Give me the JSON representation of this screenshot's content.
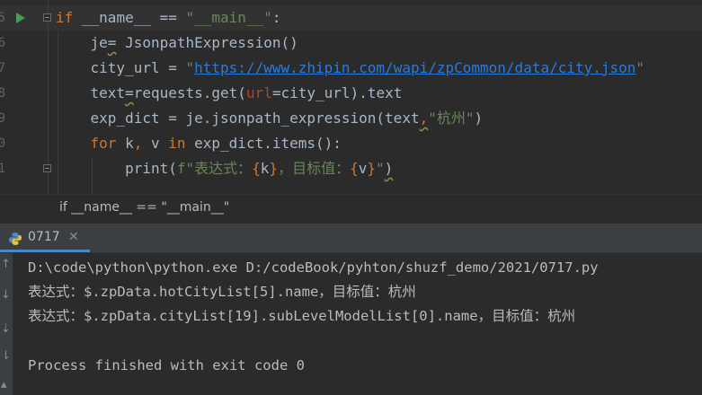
{
  "editor": {
    "lines": [
      {
        "num": "5",
        "parts": [
          {
            "t": "if ",
            "c": "kw"
          },
          {
            "t": "__name__ == ",
            "c": "nm"
          },
          {
            "t": "\"__main__\"",
            "c": "str"
          },
          {
            "t": ":",
            "c": "nm"
          }
        ]
      },
      {
        "num": "6",
        "parts": [
          {
            "t": "    je",
            "c": "nm"
          },
          {
            "t": "=",
            "c": "nm squig"
          },
          {
            "t": " JsonpathExpression()",
            "c": "nm"
          }
        ]
      },
      {
        "num": "7",
        "parts": [
          {
            "t": "    city_url = ",
            "c": "nm"
          },
          {
            "t": "\"",
            "c": "str"
          },
          {
            "t": "https://www.zhipin.com/wapi/zpCommon/data/city.json",
            "c": "url"
          },
          {
            "t": "\"",
            "c": "str"
          }
        ]
      },
      {
        "num": "8",
        "parts": [
          {
            "t": "    text",
            "c": "nm"
          },
          {
            "t": "=",
            "c": "nm squig"
          },
          {
            "t": "requests.get(",
            "c": "nm"
          },
          {
            "t": "url",
            "c": "param"
          },
          {
            "t": "=city_url).text",
            "c": "nm"
          }
        ]
      },
      {
        "num": "9",
        "parts": [
          {
            "t": "    exp_dict = je.jsonpath_expression(text",
            "c": "nm"
          },
          {
            "t": ",",
            "c": "kw squig"
          },
          {
            "t": "\"杭州\"",
            "c": "str"
          },
          {
            "t": ")",
            "c": "nm"
          }
        ]
      },
      {
        "num": "0",
        "parts": [
          {
            "t": "    ",
            "c": "nm"
          },
          {
            "t": "for ",
            "c": "kw"
          },
          {
            "t": "k",
            "c": "nm"
          },
          {
            "t": ", ",
            "c": "kw"
          },
          {
            "t": "v ",
            "c": "nm"
          },
          {
            "t": "in ",
            "c": "kw"
          },
          {
            "t": "exp_dict.items():",
            "c": "nm"
          }
        ]
      },
      {
        "num": "1",
        "parts": [
          {
            "t": "        print(",
            "c": "nm"
          },
          {
            "t": "f\"表达式：",
            "c": "str"
          },
          {
            "t": "{",
            "c": "fstr-brace"
          },
          {
            "t": "k",
            "c": "nm"
          },
          {
            "t": "}",
            "c": "fstr-brace"
          },
          {
            "t": "，目标值：",
            "c": "str"
          },
          {
            "t": "{",
            "c": "fstr-brace"
          },
          {
            "t": "v",
            "c": "nm"
          },
          {
            "t": "}",
            "c": "fstr-brace"
          },
          {
            "t": "\"",
            "c": "str"
          },
          {
            "t": ")",
            "c": "nm squig"
          }
        ]
      }
    ]
  },
  "breadcrumb": {
    "text": "if __name__ == \"__main__\""
  },
  "run_panel": {
    "tab_label": "0717",
    "output": [
      "D:\\code\\python\\python.exe D:/codeBook/pyhton/shuzf_demo/2021/0717.py",
      "表达式：$.zpData.hotCityList[5].name，目标值：杭州",
      "表达式：$.zpData.cityList[19].subLevelModelList[0].name，目标值：杭州",
      "",
      "Process finished with exit code 0"
    ]
  },
  "colors": {
    "background": "#2b2b2b",
    "keyword": "#cc7832",
    "string": "#6a8759",
    "link": "#287bde",
    "run_green": "#499c54",
    "tab_accent": "#4a88c7"
  },
  "icons": {
    "run": "run-arrow-icon",
    "python": "python-icon",
    "close": "close-icon"
  }
}
